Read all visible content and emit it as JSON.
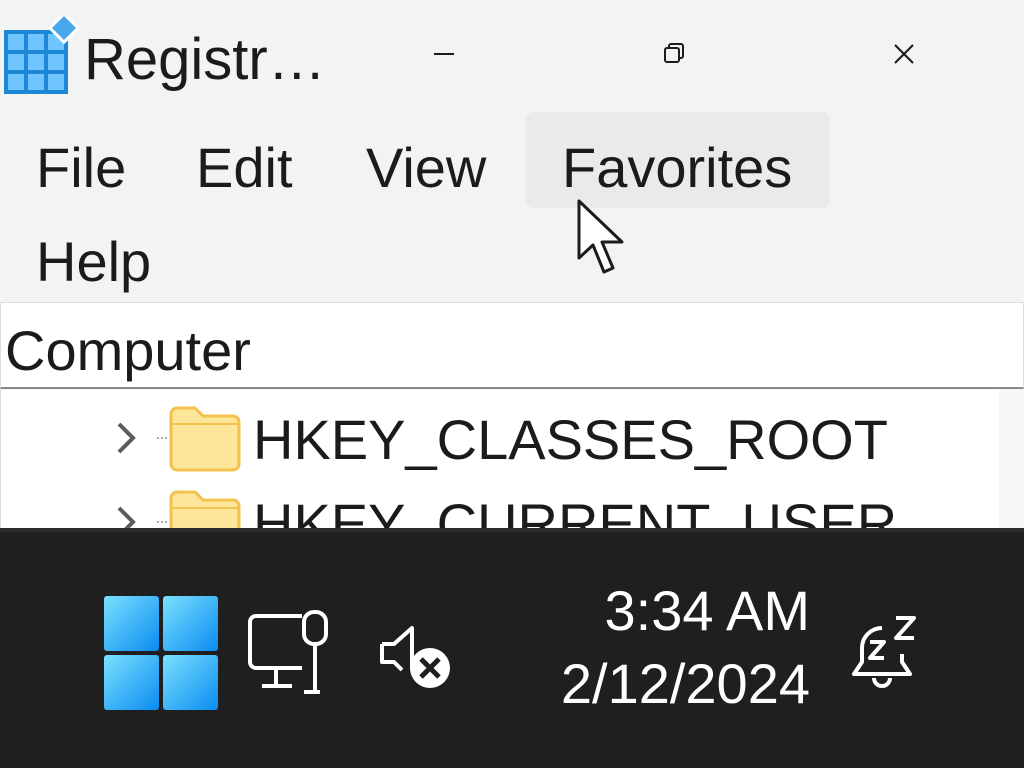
{
  "window": {
    "title": "Registr…",
    "icon": "registry-editor-icon",
    "controls": [
      "minimize-icon",
      "restore-icon",
      "close-icon"
    ]
  },
  "menu": {
    "items": [
      {
        "label": "File"
      },
      {
        "label": "Edit"
      },
      {
        "label": "View"
      },
      {
        "label": "Favorites",
        "hovered": true
      },
      {
        "label": "Help"
      }
    ]
  },
  "address": {
    "path": "Computer"
  },
  "tree": {
    "items": [
      {
        "label": "HKEY_CLASSES_ROOT",
        "icon": "folder-icon",
        "expander": "chevron-right-icon"
      },
      {
        "label": "HKEY_CURRENT_USER",
        "icon": "folder-icon",
        "expander": "chevron-right-icon"
      }
    ]
  },
  "taskbar": {
    "start_icon": "windows-start-icon",
    "tray_icons": [
      "network-ethernet-icon",
      "volume-muted-icon"
    ],
    "clock": {
      "time": "3:34 AM",
      "date": "2/12/2024"
    },
    "notification_icon": "notifications-snoozed-icon"
  },
  "colors": {
    "window_bg": "#f3f3f3",
    "taskbar_bg": "#1f1f1f",
    "folder": "#fcd869",
    "start_blue": "#1aa0f0"
  }
}
